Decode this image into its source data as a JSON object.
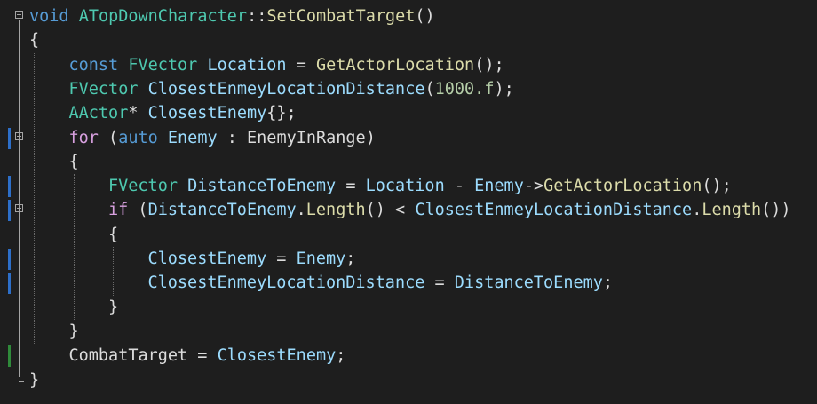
{
  "editor": {
    "colors": {
      "background": "#1e1e1e",
      "keyword": "#569cd6",
      "control": "#d8a0df",
      "type": "#4ec9b0",
      "function": "#dcdcaa",
      "variable": "#9cdcfe",
      "number": "#b5cea8",
      "plain": "#dcdcdc",
      "change_marker_modified": "#2d6fc9",
      "change_marker_saved": "#2f8a3a"
    },
    "lines": [
      {
        "indent": 0,
        "fold": true,
        "change": null,
        "tokens": [
          {
            "t": "void",
            "k": "keyword"
          },
          {
            "t": " ",
            "k": "plain"
          },
          {
            "t": "ATopDownCharacter",
            "k": "type"
          },
          {
            "t": "::",
            "k": "plain"
          },
          {
            "t": "SetCombatTarget",
            "k": "function"
          },
          {
            "t": "()",
            "k": "plain"
          }
        ]
      },
      {
        "indent": 0,
        "fold": false,
        "change": null,
        "tokens": [
          {
            "t": "{",
            "k": "plain"
          }
        ]
      },
      {
        "indent": 1,
        "fold": false,
        "change": null,
        "tokens": [
          {
            "t": "const",
            "k": "keyword"
          },
          {
            "t": " ",
            "k": "plain"
          },
          {
            "t": "FVector",
            "k": "type"
          },
          {
            "t": " ",
            "k": "plain"
          },
          {
            "t": "Location",
            "k": "variable"
          },
          {
            "t": " = ",
            "k": "plain"
          },
          {
            "t": "GetActorLocation",
            "k": "function"
          },
          {
            "t": "();",
            "k": "plain"
          }
        ]
      },
      {
        "indent": 1,
        "fold": false,
        "change": null,
        "tokens": [
          {
            "t": "FVector",
            "k": "type"
          },
          {
            "t": " ",
            "k": "plain"
          },
          {
            "t": "ClosestEnmeyLocationDistance",
            "k": "variable"
          },
          {
            "t": "(",
            "k": "plain"
          },
          {
            "t": "1000.f",
            "k": "number"
          },
          {
            "t": ");",
            "k": "plain"
          }
        ]
      },
      {
        "indent": 1,
        "fold": false,
        "change": null,
        "tokens": [
          {
            "t": "AActor",
            "k": "type"
          },
          {
            "t": "* ",
            "k": "plain"
          },
          {
            "t": "ClosestEnemy",
            "k": "variable"
          },
          {
            "t": "{};",
            "k": "plain"
          }
        ]
      },
      {
        "indent": 1,
        "fold": true,
        "change": "blue",
        "tokens": [
          {
            "t": "for",
            "k": "control"
          },
          {
            "t": " (",
            "k": "plain"
          },
          {
            "t": "auto",
            "k": "keyword"
          },
          {
            "t": " ",
            "k": "plain"
          },
          {
            "t": "Enemy",
            "k": "variable"
          },
          {
            "t": " : ",
            "k": "plain"
          },
          {
            "t": "EnemyInRange",
            "k": "plain"
          },
          {
            "t": ")",
            "k": "plain"
          }
        ]
      },
      {
        "indent": 1,
        "fold": false,
        "change": null,
        "tokens": [
          {
            "t": "{",
            "k": "plain"
          }
        ]
      },
      {
        "indent": 2,
        "fold": false,
        "change": "blue",
        "tokens": [
          {
            "t": "FVector",
            "k": "type"
          },
          {
            "t": " ",
            "k": "plain"
          },
          {
            "t": "DistanceToEnemy",
            "k": "variable"
          },
          {
            "t": " = ",
            "k": "plain"
          },
          {
            "t": "Location",
            "k": "variable"
          },
          {
            "t": " - ",
            "k": "plain"
          },
          {
            "t": "Enemy",
            "k": "variable"
          },
          {
            "t": "->",
            "k": "plain"
          },
          {
            "t": "GetActorLocation",
            "k": "function"
          },
          {
            "t": "();",
            "k": "plain"
          }
        ]
      },
      {
        "indent": 2,
        "fold": true,
        "change": "blue",
        "tokens": [
          {
            "t": "if",
            "k": "control"
          },
          {
            "t": " (",
            "k": "plain"
          },
          {
            "t": "DistanceToEnemy",
            "k": "variable"
          },
          {
            "t": ".",
            "k": "plain"
          },
          {
            "t": "Length",
            "k": "function"
          },
          {
            "t": "() < ",
            "k": "plain"
          },
          {
            "t": "ClosestEnmeyLocationDistance",
            "k": "variable"
          },
          {
            "t": ".",
            "k": "plain"
          },
          {
            "t": "Length",
            "k": "function"
          },
          {
            "t": "())",
            "k": "plain"
          }
        ]
      },
      {
        "indent": 2,
        "fold": false,
        "change": null,
        "tokens": [
          {
            "t": "{",
            "k": "plain"
          }
        ]
      },
      {
        "indent": 3,
        "fold": false,
        "change": "blue",
        "tokens": [
          {
            "t": "ClosestEnemy",
            "k": "variable"
          },
          {
            "t": " = ",
            "k": "plain"
          },
          {
            "t": "Enemy",
            "k": "variable"
          },
          {
            "t": ";",
            "k": "plain"
          }
        ]
      },
      {
        "indent": 3,
        "fold": false,
        "change": "blue",
        "tokens": [
          {
            "t": "ClosestEnmeyLocationDistance",
            "k": "variable"
          },
          {
            "t": " = ",
            "k": "plain"
          },
          {
            "t": "DistanceToEnemy",
            "k": "variable"
          },
          {
            "t": ";",
            "k": "plain"
          }
        ]
      },
      {
        "indent": 2,
        "fold": false,
        "change": null,
        "tokens": [
          {
            "t": "}",
            "k": "plain"
          }
        ]
      },
      {
        "indent": 1,
        "fold": false,
        "change": null,
        "tokens": [
          {
            "t": "}",
            "k": "plain"
          }
        ]
      },
      {
        "indent": 1,
        "fold": false,
        "change": "green",
        "tokens": [
          {
            "t": "CombatTarget",
            "k": "plain"
          },
          {
            "t": " = ",
            "k": "plain"
          },
          {
            "t": "ClosestEnemy",
            "k": "variable"
          },
          {
            "t": ";",
            "k": "plain"
          }
        ]
      },
      {
        "indent": 0,
        "fold": false,
        "change": null,
        "tokens": [
          {
            "t": "}",
            "k": "plain"
          }
        ]
      }
    ]
  }
}
